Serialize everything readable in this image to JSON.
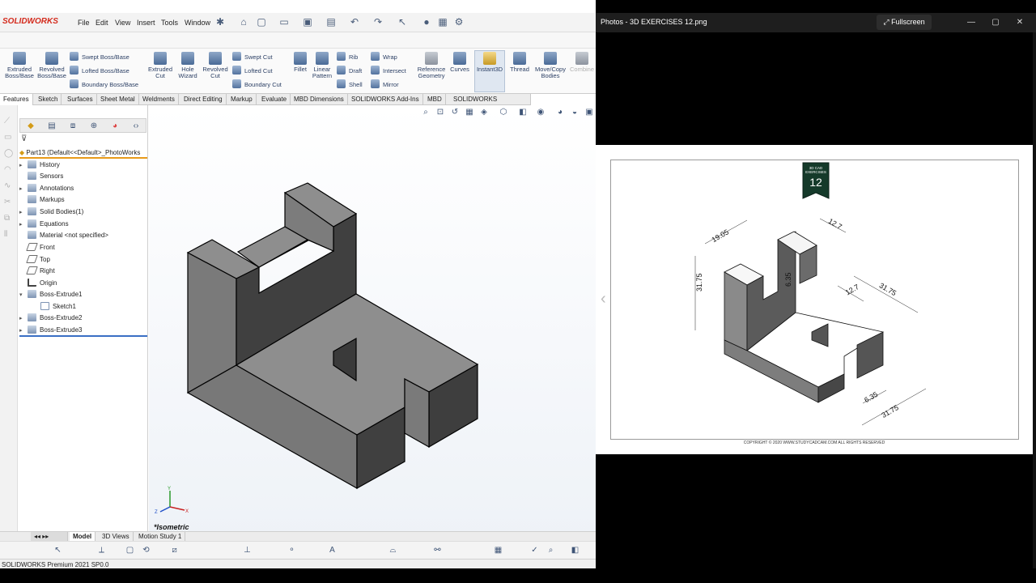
{
  "solidworks": {
    "logo": "SOLIDWORKS",
    "menu": [
      "File",
      "Edit",
      "View",
      "Insert",
      "Tools",
      "Window"
    ],
    "features": {
      "extruded_boss": "Extruded Boss/Base",
      "revolved_boss": "Revolved Boss/Base",
      "swept_boss": "Swept Boss/Base",
      "lofted_boss": "Lofted Boss/Base",
      "boundary_boss": "Boundary Boss/Base",
      "extruded_cut": "Extruded Cut",
      "hole_wizard": "Hole Wizard",
      "revolved_cut": "Revolved Cut",
      "swept_cut": "Swept Cut",
      "lofted_cut": "Lofted Cut",
      "boundary_cut": "Boundary Cut",
      "fillet": "Fillet",
      "linear_pattern": "Linear Pattern",
      "rib": "Rib",
      "draft": "Draft",
      "shell": "Shell",
      "wrap": "Wrap",
      "intersect": "Intersect",
      "mirror": "Mirror",
      "reference_geometry": "Reference Geometry",
      "curves": "Curves",
      "instant3d": "Instant3D",
      "thread": "Thread",
      "move_copy": "Move/Copy Bodies",
      "combine": "Combine"
    },
    "tabs": [
      "Features",
      "Sketch",
      "Surfaces",
      "Sheet Metal",
      "Weldments",
      "Direct Editing",
      "Markup",
      "Evaluate",
      "MBD Dimensions",
      "SOLIDWORKS Add-Ins",
      "MBD",
      "SOLIDWORKS Inspection"
    ],
    "tree": {
      "part": "Part13  (Default<<Default>_PhotoWorks",
      "items": [
        "History",
        "Sensors",
        "Annotations",
        "Markups",
        "Solid Bodies(1)",
        "Equations",
        "Material <not specified>",
        "Front",
        "Top",
        "Right",
        "Origin",
        "Boss-Extrude1",
        "Sketch1",
        "Boss-Extrude2",
        "Boss-Extrude3"
      ]
    },
    "view_label": "*Isometric",
    "bottom_tabs": [
      "Model",
      "3D Views",
      "Motion Study 1"
    ],
    "status": "SOLIDWORKS Premium 2021 SP0.0",
    "triad": {
      "x": "X",
      "y": "Y",
      "z": "Z"
    }
  },
  "photos": {
    "title": "Photos - 3D EXERCISES 12.png",
    "fullscreen": "Fullscreen",
    "badge": {
      "line1": "3D CAD",
      "line2": "EXERCISES",
      "number": "12"
    },
    "dimensions": [
      "19.05",
      "12.7",
      "31.75",
      "6.35",
      "12.7",
      "31.75",
      "6.35",
      "31.75"
    ],
    "copyright": "COPYRIGHT © 2020 WWW.STUDYCADCAM.COM ALL RIGHTS RESERVED"
  }
}
